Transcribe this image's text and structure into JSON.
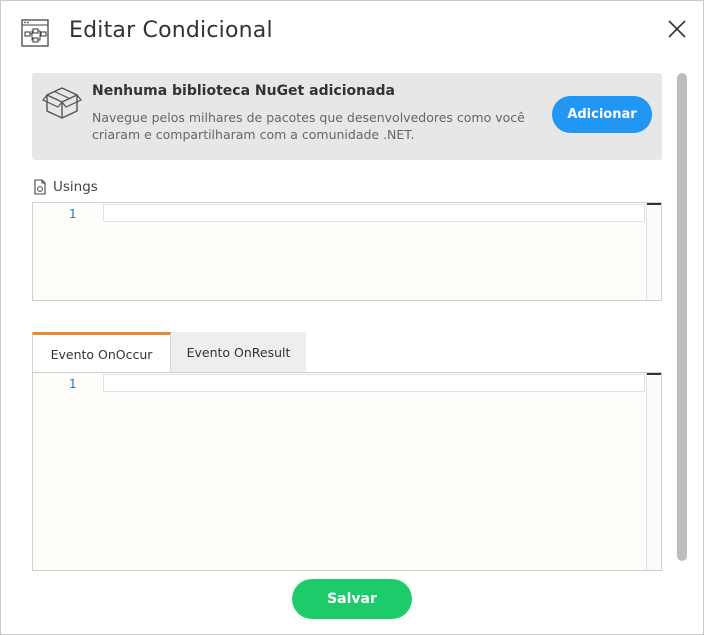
{
  "dialog": {
    "title": "Editar Condicional",
    "header_icon": "flowchart-icon",
    "close_icon": "close-icon"
  },
  "nuget": {
    "icon": "package-box-icon",
    "title": "Nenhuma biblioteca NuGet adicionada",
    "description": "Navegue pelos milhares de pacotes que desenvolvedores como você criaram e compartilharam com a comunidade .NET.",
    "add_button": "Adicionar"
  },
  "usings": {
    "icon": "file-code-icon",
    "label": "Usings",
    "line_number": "1",
    "code": ""
  },
  "event_tabs": [
    {
      "label": "Evento OnOccur",
      "active": true
    },
    {
      "label": "Evento OnResult",
      "active": false
    }
  ],
  "event_editor": {
    "line_number": "1",
    "code": ""
  },
  "footer": {
    "save_button": "Salvar"
  },
  "colors": {
    "primary_blue": "#2196f3",
    "save_green": "#1ecb6b",
    "active_tab_accent": "#e88a2f",
    "line_number": "#2a6fb3"
  }
}
